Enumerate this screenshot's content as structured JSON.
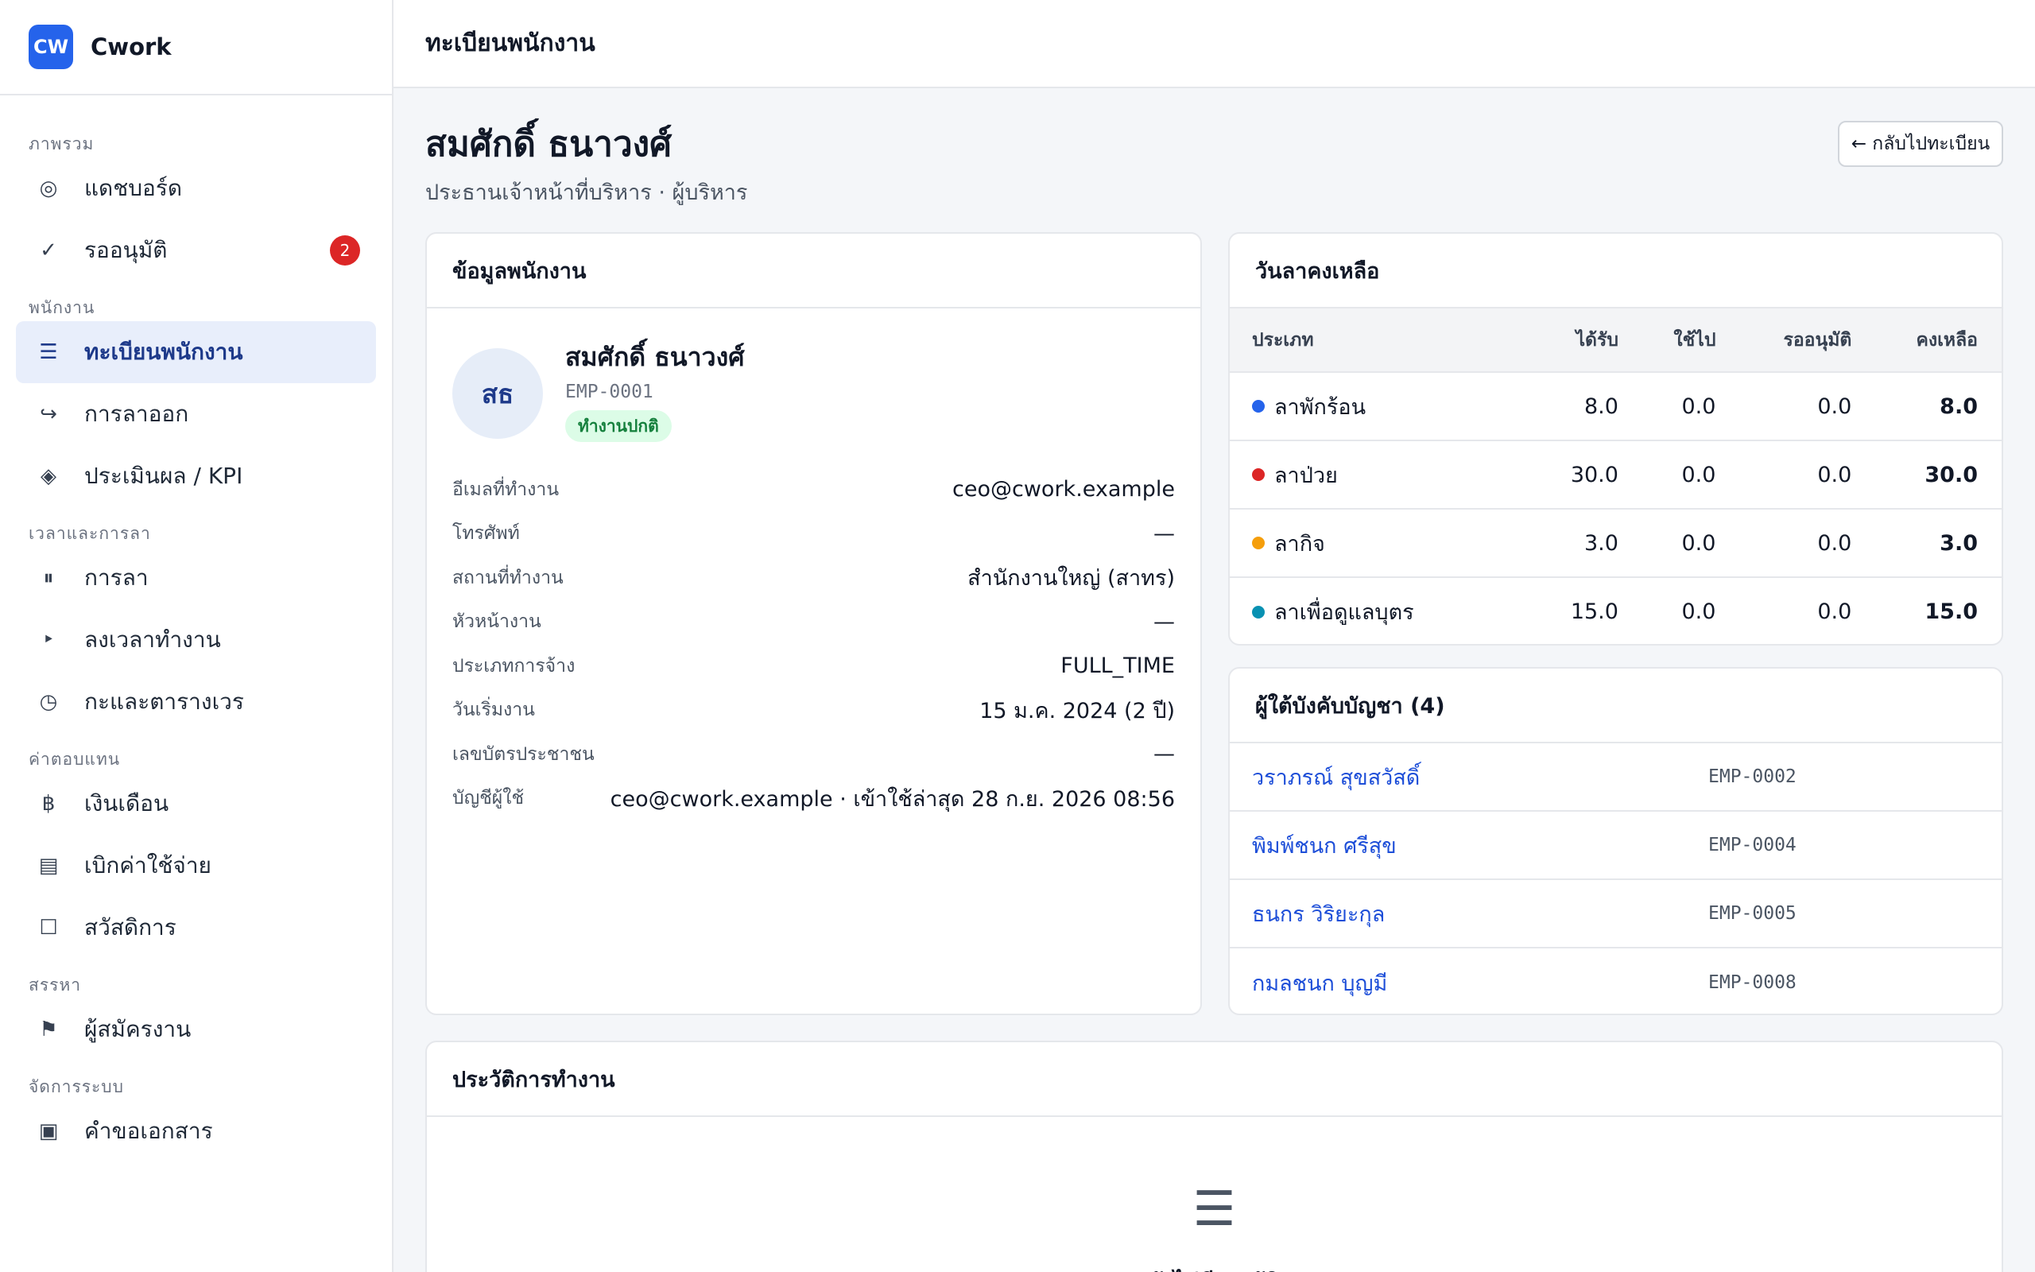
{
  "brand": {
    "logo": "CW",
    "name": "Cwork"
  },
  "sidebar": {
    "sections": [
      {
        "title": "ภาพรวม",
        "items": [
          {
            "icon": "◎",
            "icon_name": "target-icon",
            "label": "แดชบอร์ด"
          },
          {
            "icon": "✓",
            "icon_name": "check-icon",
            "label": "รออนุมัติ",
            "badge": "2"
          }
        ]
      },
      {
        "title": "พนักงาน",
        "items": [
          {
            "icon": "☰",
            "icon_name": "list-icon",
            "label": "ทะเบียนพนักงาน",
            "active": true
          },
          {
            "icon": "↪",
            "icon_name": "exit-arrow-icon",
            "label": "การลาออก"
          },
          {
            "icon": "◈",
            "icon_name": "diamond-icon",
            "label": "ประเมินผล / KPI"
          }
        ]
      },
      {
        "title": "เวลาและการลา",
        "items": [
          {
            "icon": "⏸",
            "icon_name": "pause-icon",
            "label": "การลา"
          },
          {
            "icon": "‣",
            "icon_name": "bullet-icon",
            "label": "ลงเวลาทำงาน"
          },
          {
            "icon": "◷",
            "icon_name": "clock-icon",
            "label": "กะและตารางเวร"
          }
        ]
      },
      {
        "title": "ค่าตอบแทน",
        "items": [
          {
            "icon": "฿",
            "icon_name": "baht-icon",
            "label": "เงินเดือน"
          },
          {
            "icon": "▤",
            "icon_name": "receipt-icon",
            "label": "เบิกค่าใช้จ่าย"
          },
          {
            "icon": "☐",
            "icon_name": "box-icon",
            "label": "สวัสดิการ"
          }
        ]
      },
      {
        "title": "สรรหา",
        "items": [
          {
            "icon": "⚑",
            "icon_name": "flag-icon",
            "label": "ผู้สมัครงาน"
          }
        ]
      },
      {
        "title": "จัดการระบบ",
        "items": [
          {
            "icon": "▣",
            "icon_name": "document-icon",
            "label": "คำขอเอกสาร"
          }
        ]
      }
    ]
  },
  "topbar": {
    "title": "ทะเบียนพนักงาน"
  },
  "header": {
    "name": "สมศักดิ์ ธนาวงศ์",
    "subtitle": "ประธานเจ้าหน้าที่บริหาร · ผู้บริหาร",
    "back_label": "← กลับไปทะเบียน"
  },
  "info": {
    "title": "ข้อมูลพนักงาน",
    "initials": "สธ",
    "name": "สมศักดิ์ ธนาวงศ์",
    "code": "EMP-0001",
    "status": "ทำงานปกติ",
    "fields": [
      {
        "label": "อีเมลที่ทำงาน",
        "value": "ceo@cwork.example"
      },
      {
        "label": "โทรศัพท์",
        "value": "—"
      },
      {
        "label": "สถานที่ทำงาน",
        "value": "สำนักงานใหญ่ (สาทร)"
      },
      {
        "label": "หัวหน้างาน",
        "value": "—"
      },
      {
        "label": "ประเภทการจ้าง",
        "value": "FULL_TIME"
      },
      {
        "label": "วันเริ่มงาน",
        "value": "15 ม.ค. 2024 (2 ปี)"
      },
      {
        "label": "เลขบัตรประชาชน",
        "value": "—"
      },
      {
        "label": "บัญชีผู้ใช้",
        "value": "ceo@cwork.example · เข้าใช้ล่าสุด 28 ก.ย. 2026 08:56"
      }
    ]
  },
  "leave": {
    "title": "วันลาคงเหลือ",
    "columns": [
      "ประเภท",
      "ได้รับ",
      "ใช้ไป",
      "รออนุมัติ",
      "คงเหลือ"
    ],
    "rows": [
      {
        "type": "ลาพักร้อน",
        "color": "#2563eb",
        "granted": "8.0",
        "used": "0.0",
        "pending": "0.0",
        "remaining": "8.0"
      },
      {
        "type": "ลาป่วย",
        "color": "#dc2626",
        "granted": "30.0",
        "used": "0.0",
        "pending": "0.0",
        "remaining": "30.0"
      },
      {
        "type": "ลากิจ",
        "color": "#f59e0b",
        "granted": "3.0",
        "used": "0.0",
        "pending": "0.0",
        "remaining": "3.0"
      },
      {
        "type": "ลาเพื่อดูแลบุตร",
        "color": "#0891b2",
        "granted": "15.0",
        "used": "0.0",
        "pending": "0.0",
        "remaining": "15.0"
      }
    ]
  },
  "subordinates": {
    "title": "ผู้ใต้บังคับบัญชา (4)",
    "items": [
      {
        "name": "วราภรณ์ สุขสวัสดิ์",
        "code": "EMP-0002"
      },
      {
        "name": "พิมพ์ชนก ศรีสุข",
        "code": "EMP-0004"
      },
      {
        "name": "ธนกร วิริยะกุล",
        "code": "EMP-0005"
      },
      {
        "name": "กมลชนก บุญมี",
        "code": "EMP-0008"
      }
    ]
  },
  "history": {
    "title": "ประวัติการทำงาน",
    "empty_icon": "☰",
    "empty_text": "ยังไม่มีประวัติ"
  }
}
